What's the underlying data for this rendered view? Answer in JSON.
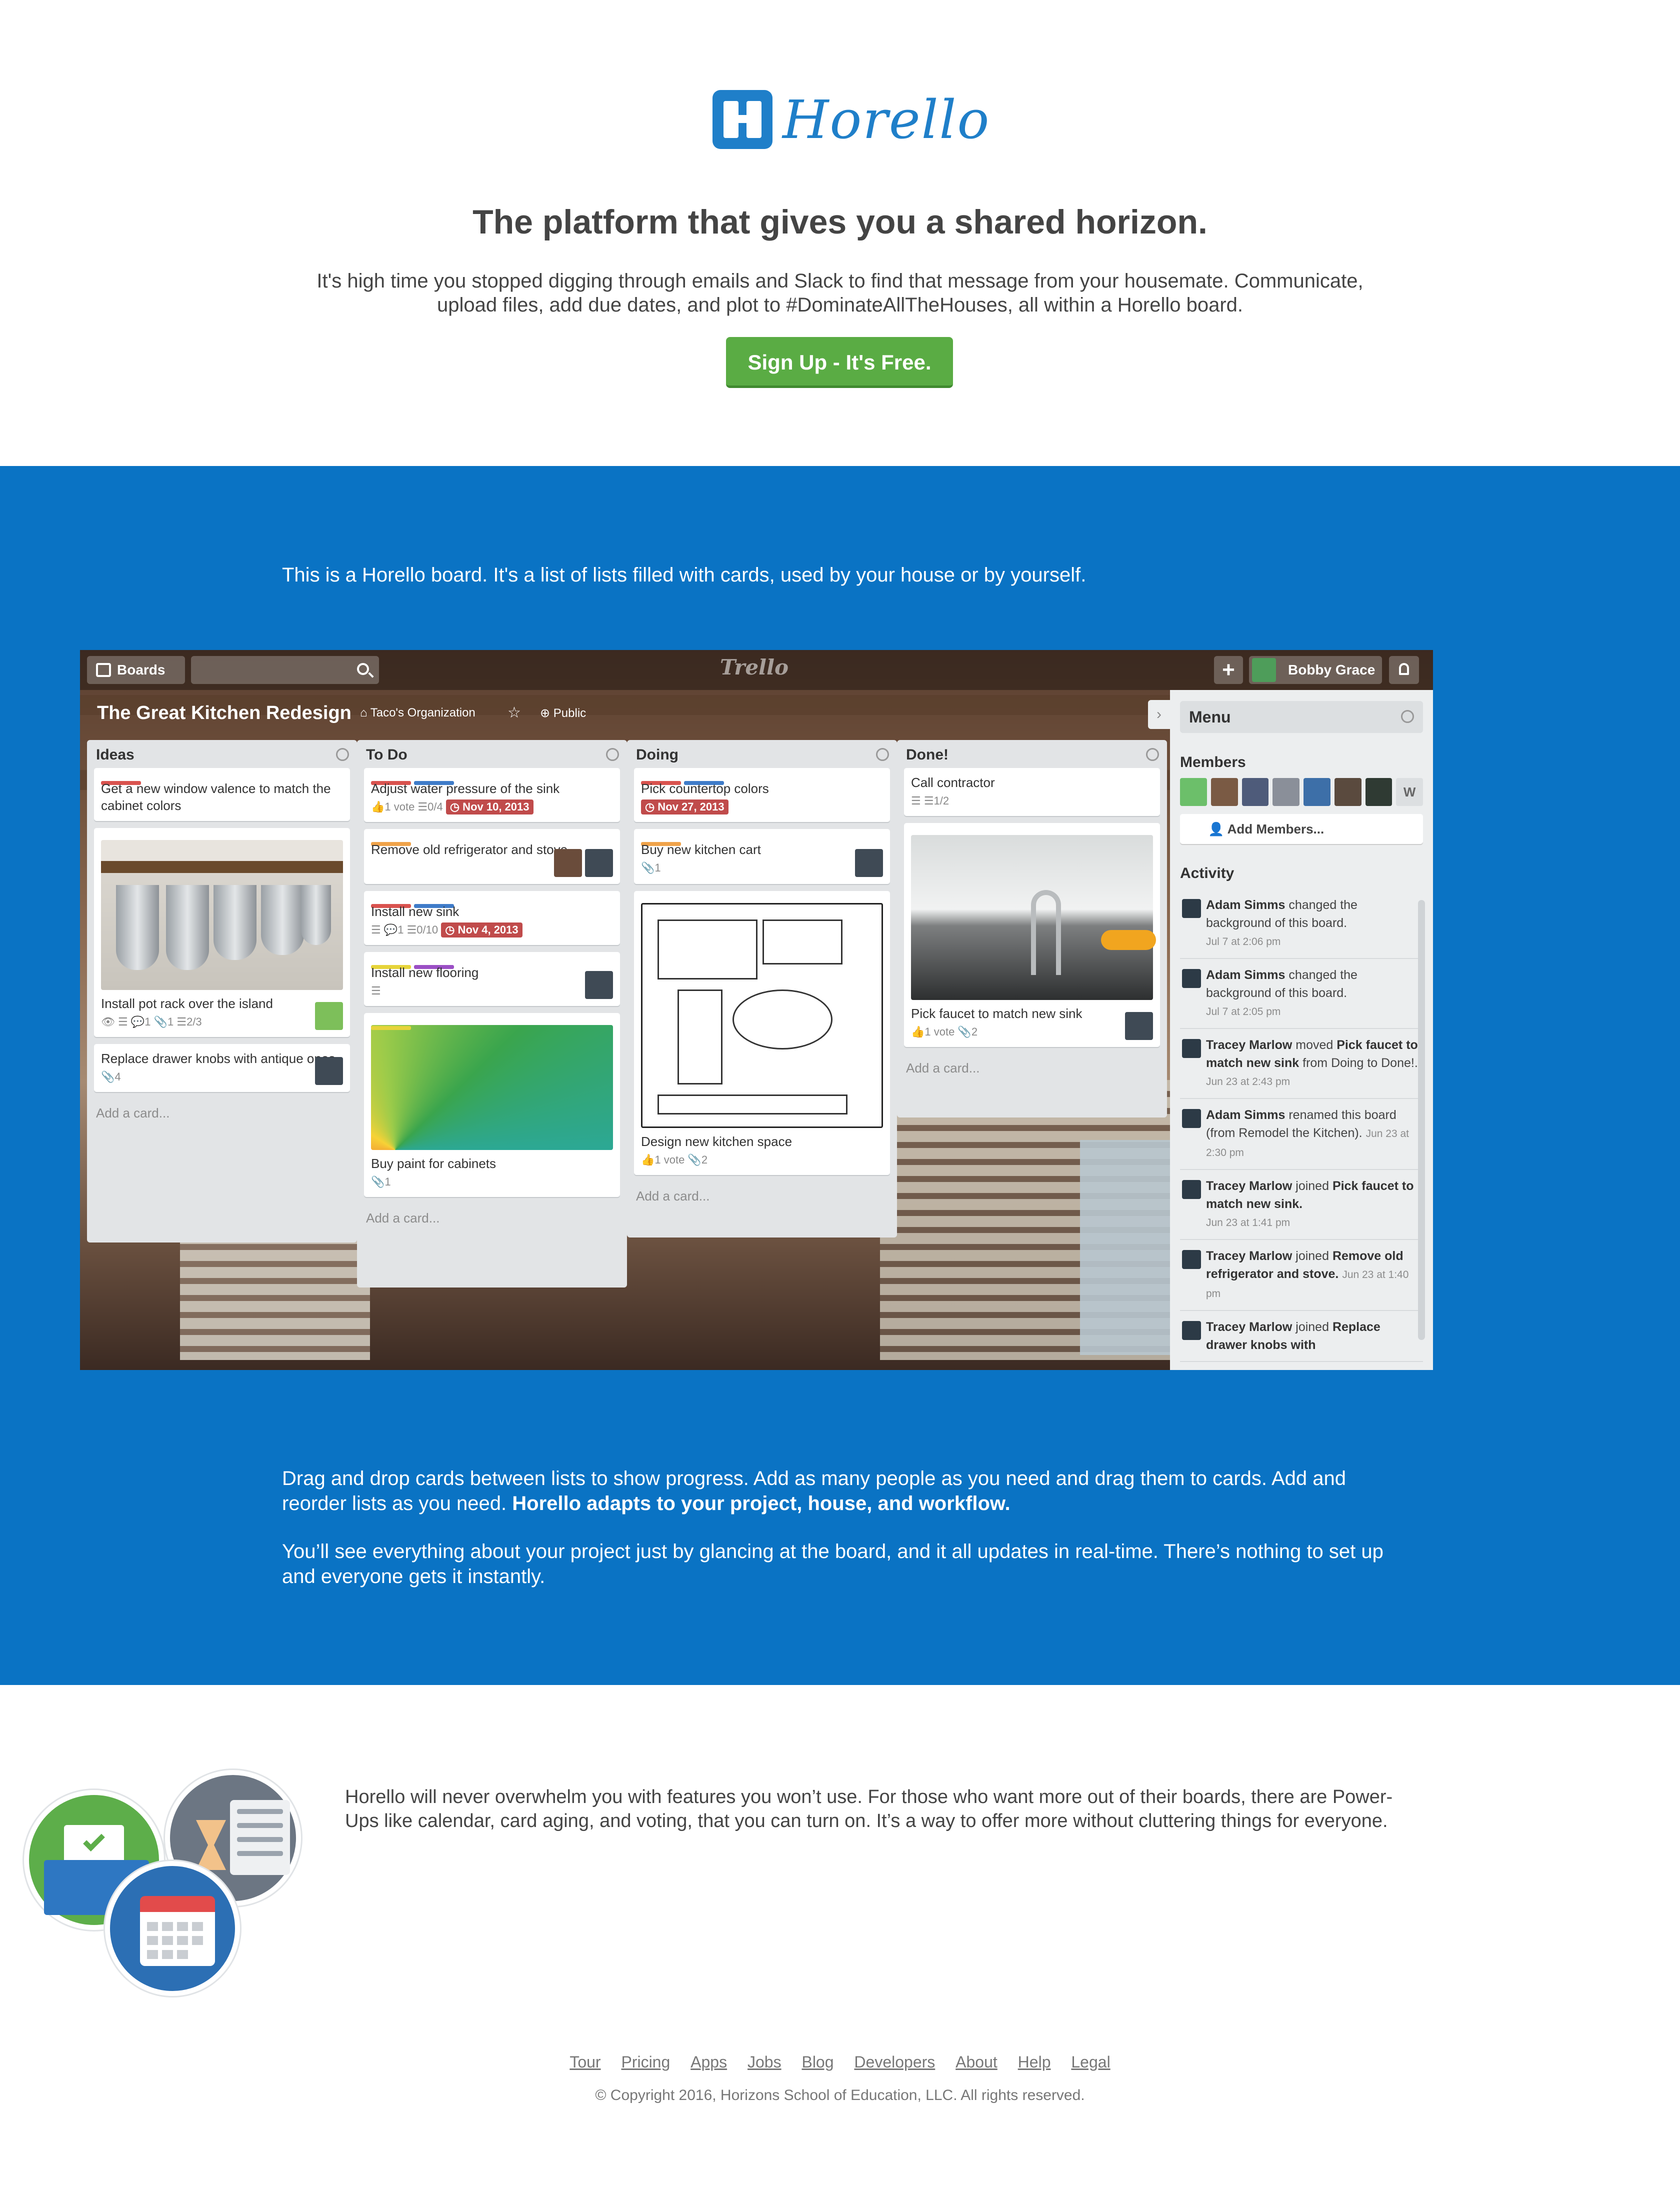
{
  "brand": {
    "name": "Horello",
    "color": "#1f7fc9"
  },
  "hero": {
    "headline": "The platform that gives you a shared horizon.",
    "subline": "It's high time you stopped digging through emails and Slack to find that message from your housemate. Communicate, upload files, add due dates, and plot to #DominateAllTheHouses, all within a Horello board.",
    "cta": "Sign Up - It's Free."
  },
  "board_section": {
    "intro": "This is a Horello board. It's a list of lists filled with cards, used by your house or by yourself.",
    "p1_text": "Drag and drop cards between lists to show progress. Add as many people as you need and drag them to cards. Add and reorder lists as you need.",
    "p1_bold": "Horello adapts to your project, house, and workflow.",
    "p2": "You’ll see everything about your project just by glancing at the board, and it all updates in real-time. There’s nothing to set up and everyone gets it instantly."
  },
  "board": {
    "topbar": {
      "boards": "Boards",
      "app_logo": "Trello",
      "user": "Bobby Grace",
      "plus": "+"
    },
    "title": "The Great Kitchen Redesign",
    "org": "Taco's Organization",
    "star": "☆",
    "visibility": "Public",
    "add_card": "Add a card...",
    "lists": [
      {
        "title": "Ideas",
        "cards": [
          {
            "text": "Get a new window valence to match the cabinet colors"
          },
          {
            "text": "Install pot rack over the island",
            "badges": "👁 ☰ 💬1 📎1 ☰2/3"
          },
          {
            "text": "Replace drawer knobs with antique ones",
            "badges": "📎4"
          }
        ]
      },
      {
        "title": "To Do",
        "cards": [
          {
            "text": "Adjust water pressure of the sink",
            "badges": "👍1 vote ☰0/4",
            "due": "◷ Nov 10, 2013"
          },
          {
            "text": "Remove old refrigerator and stove"
          },
          {
            "text": "Install new sink",
            "badges": "☰ 💬1 ☰0/10",
            "due": "◷ Nov 4, 2013"
          },
          {
            "text": "Install new flooring",
            "badges": "☰"
          },
          {
            "text": "Buy paint for cabinets",
            "badges": "📎1"
          }
        ]
      },
      {
        "title": "Doing",
        "cards": [
          {
            "text": "Pick countertop colors",
            "due": "◷ Nov 27, 2013"
          },
          {
            "text": "Buy new kitchen cart",
            "badges": "📎1"
          },
          {
            "text": "Design new kitchen space",
            "badges": "👍1 vote 📎2"
          }
        ]
      },
      {
        "title": "Done!",
        "cards": [
          {
            "text": "Call contractor",
            "badges": "☰ ☰1/2"
          },
          {
            "text": "Pick faucet to match new sink",
            "badges": "👍1 vote 📎2"
          }
        ]
      }
    ],
    "menu": {
      "title": "Menu",
      "members_heading": "Members",
      "member_last": "W",
      "add_members": "Add Members...",
      "activity_heading": "Activity",
      "activity": [
        {
          "who": "Adam Simms",
          "text": " changed the background of this board.",
          "when": "Jul 7 at 2:06 pm"
        },
        {
          "who": "Adam Simms",
          "text": " changed the background of this board.",
          "when": "Jul 7 at 2:05 pm"
        },
        {
          "who": "Tracey Marlow",
          "text": " moved ",
          "bold": "Pick faucet to match new sink",
          "text2": " from Doing to Done!.",
          "when": "Jun 23 at 2:43 pm"
        },
        {
          "who": "Adam Simms",
          "text": " renamed this board (from Remodel the Kitchen).",
          "when": "Jun 23 at 2:30 pm"
        },
        {
          "who": "Tracey Marlow",
          "text": " joined ",
          "bold": "Pick faucet to match new sink.",
          "when": "Jun 23 at 1:41 pm"
        },
        {
          "who": "Tracey Marlow",
          "text": " joined ",
          "bold": "Remove old refrigerator and stove.",
          "when": "Jun 23 at 1:40 pm"
        },
        {
          "who": "Tracey Marlow",
          "text": " joined ",
          "bold": "Replace drawer knobs with",
          "when": ""
        }
      ]
    }
  },
  "powerups": {
    "text": "Horello will never overwhelm you with features you won’t use. For those who want more out of their boards, there are Power-Ups like calendar, card aging, and voting, that you can turn on. It’s a way to offer more without cluttering things for everyone."
  },
  "footer": {
    "links": [
      "Tour",
      "Pricing",
      "Apps",
      "Jobs",
      "Blog",
      "Developers",
      "About",
      "Help",
      "Legal"
    ],
    "copyright": "© Copyright 2016, Horizons School of Education, LLC. All rights reserved."
  },
  "colors": {
    "blue_section": "#0a73c4",
    "cta": "#5aac44",
    "due": "#c04b4b"
  }
}
